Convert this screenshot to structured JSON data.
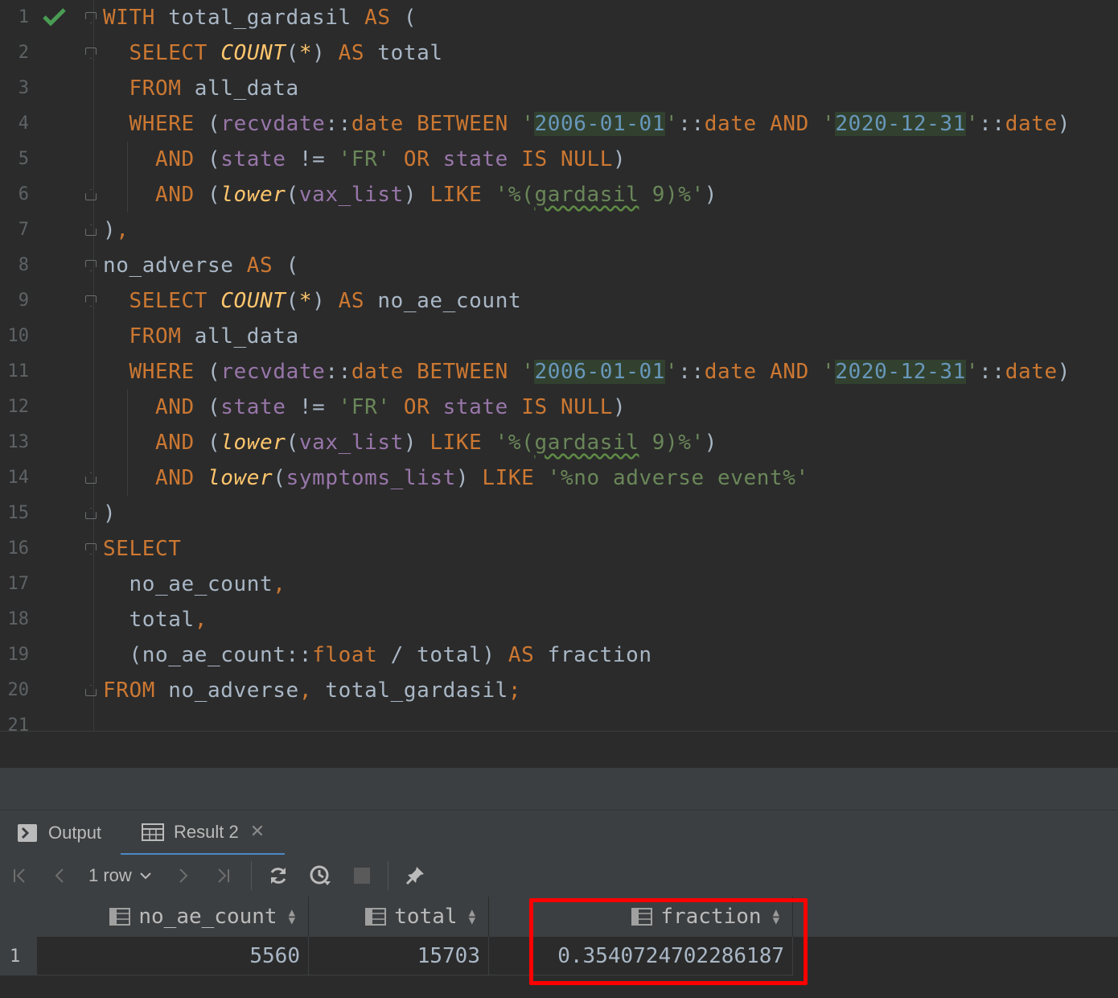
{
  "editor": {
    "status_icon": "check-icon",
    "lines": [
      {
        "n": "1"
      },
      {
        "n": "2"
      },
      {
        "n": "3"
      },
      {
        "n": "4"
      },
      {
        "n": "5"
      },
      {
        "n": "6"
      },
      {
        "n": "7"
      },
      {
        "n": "8"
      },
      {
        "n": "9"
      },
      {
        "n": "10"
      },
      {
        "n": "11"
      },
      {
        "n": "12"
      },
      {
        "n": "13"
      },
      {
        "n": "14"
      },
      {
        "n": "15"
      },
      {
        "n": "16"
      },
      {
        "n": "17"
      },
      {
        "n": "18"
      },
      {
        "n": "19"
      },
      {
        "n": "20"
      },
      {
        "n": "21"
      }
    ],
    "code": [
      [
        [
          "kw",
          "WITH"
        ],
        [
          "op",
          " total_gardasil "
        ],
        [
          "kw",
          "AS"
        ],
        [
          "op",
          " ("
        ]
      ],
      [
        [
          "op",
          "  "
        ],
        [
          "kw",
          "SELECT"
        ],
        [
          "op",
          " "
        ],
        [
          "fn",
          "COUNT"
        ],
        [
          "op",
          "("
        ],
        [
          "fn",
          "*"
        ],
        [
          "op",
          ") "
        ],
        [
          "kw",
          "AS"
        ],
        [
          "op",
          " total"
        ]
      ],
      [
        [
          "op",
          "  "
        ],
        [
          "kw",
          "FROM"
        ],
        [
          "op",
          " all_data"
        ]
      ],
      [
        [
          "op",
          "  "
        ],
        [
          "kw",
          "WHERE"
        ],
        [
          "op",
          " ("
        ],
        [
          "col",
          "recvdate"
        ],
        [
          "op",
          "::"
        ],
        [
          "kw",
          "date"
        ],
        [
          "op",
          " "
        ],
        [
          "kw",
          "BETWEEN"
        ],
        [
          "op",
          " "
        ],
        [
          "str",
          "'"
        ],
        [
          "dt",
          "2006-01-01"
        ],
        [
          "str",
          "'"
        ],
        [
          "op",
          "::"
        ],
        [
          "kw",
          "date"
        ],
        [
          "op",
          " "
        ],
        [
          "kw",
          "AND"
        ],
        [
          "op",
          " "
        ],
        [
          "str",
          "'"
        ],
        [
          "dt",
          "2020-12-31"
        ],
        [
          "str",
          "'"
        ],
        [
          "op",
          "::"
        ],
        [
          "kw",
          "date"
        ],
        [
          "op",
          ")"
        ]
      ],
      [
        [
          "op",
          "    "
        ],
        [
          "kw",
          "AND"
        ],
        [
          "op",
          " ("
        ],
        [
          "col",
          "state"
        ],
        [
          "op",
          " != "
        ],
        [
          "str",
          "'FR'"
        ],
        [
          "op",
          " "
        ],
        [
          "kw",
          "OR"
        ],
        [
          "op",
          " "
        ],
        [
          "col",
          "state"
        ],
        [
          "op",
          " "
        ],
        [
          "kw",
          "IS NULL"
        ],
        [
          "op",
          ")"
        ]
      ],
      [
        [
          "op",
          "    "
        ],
        [
          "kw",
          "AND"
        ],
        [
          "op",
          " ("
        ],
        [
          "fn",
          "lower"
        ],
        [
          "op",
          "("
        ],
        [
          "col",
          "vax_list"
        ],
        [
          "op",
          ") "
        ],
        [
          "kw",
          "LIKE"
        ],
        [
          "op",
          " "
        ],
        [
          "str",
          "'%("
        ],
        [
          "strtypo",
          "gardasil"
        ],
        [
          "str",
          " 9)%'"
        ],
        [
          "op",
          ")"
        ]
      ],
      [
        [
          "op",
          ")"
        ],
        [
          "kw",
          ","
        ]
      ],
      [
        [
          "op",
          "no_adverse "
        ],
        [
          "kw",
          "AS"
        ],
        [
          "op",
          " ("
        ]
      ],
      [
        [
          "op",
          "  "
        ],
        [
          "kw",
          "SELECT"
        ],
        [
          "op",
          " "
        ],
        [
          "fn",
          "COUNT"
        ],
        [
          "op",
          "("
        ],
        [
          "fn",
          "*"
        ],
        [
          "op",
          ") "
        ],
        [
          "kw",
          "AS"
        ],
        [
          "op",
          " no_ae_count"
        ]
      ],
      [
        [
          "op",
          "  "
        ],
        [
          "kw",
          "FROM"
        ],
        [
          "op",
          " all_data"
        ]
      ],
      [
        [
          "op",
          "  "
        ],
        [
          "kw",
          "WHERE"
        ],
        [
          "op",
          " ("
        ],
        [
          "col",
          "recvdate"
        ],
        [
          "op",
          "::"
        ],
        [
          "kw",
          "date"
        ],
        [
          "op",
          " "
        ],
        [
          "kw",
          "BETWEEN"
        ],
        [
          "op",
          " "
        ],
        [
          "str",
          "'"
        ],
        [
          "dt",
          "2006-01-01"
        ],
        [
          "str",
          "'"
        ],
        [
          "op",
          "::"
        ],
        [
          "kw",
          "date"
        ],
        [
          "op",
          " "
        ],
        [
          "kw",
          "AND"
        ],
        [
          "op",
          " "
        ],
        [
          "str",
          "'"
        ],
        [
          "dt",
          "2020-12-31"
        ],
        [
          "str",
          "'"
        ],
        [
          "op",
          "::"
        ],
        [
          "kw",
          "date"
        ],
        [
          "op",
          ")"
        ]
      ],
      [
        [
          "op",
          "    "
        ],
        [
          "kw",
          "AND"
        ],
        [
          "op",
          " ("
        ],
        [
          "col",
          "state"
        ],
        [
          "op",
          " != "
        ],
        [
          "str",
          "'FR'"
        ],
        [
          "op",
          " "
        ],
        [
          "kw",
          "OR"
        ],
        [
          "op",
          " "
        ],
        [
          "col",
          "state"
        ],
        [
          "op",
          " "
        ],
        [
          "kw",
          "IS NULL"
        ],
        [
          "op",
          ")"
        ]
      ],
      [
        [
          "op",
          "    "
        ],
        [
          "kw",
          "AND"
        ],
        [
          "op",
          " ("
        ],
        [
          "fn",
          "lower"
        ],
        [
          "op",
          "("
        ],
        [
          "col",
          "vax_list"
        ],
        [
          "op",
          ") "
        ],
        [
          "kw",
          "LIKE"
        ],
        [
          "op",
          " "
        ],
        [
          "str",
          "'%("
        ],
        [
          "strtypo",
          "gardasil"
        ],
        [
          "str",
          " 9)%'"
        ],
        [
          "op",
          ")"
        ]
      ],
      [
        [
          "op",
          "    "
        ],
        [
          "kw",
          "AND"
        ],
        [
          "op",
          " "
        ],
        [
          "fn",
          "lower"
        ],
        [
          "op",
          "("
        ],
        [
          "col",
          "symptoms_list"
        ],
        [
          "op",
          ") "
        ],
        [
          "kw",
          "LIKE"
        ],
        [
          "op",
          " "
        ],
        [
          "str",
          "'%no adverse event%'"
        ]
      ],
      [
        [
          "op",
          ")"
        ]
      ],
      [
        [
          "kw",
          "SELECT"
        ]
      ],
      [
        [
          "op",
          "  no_ae_count"
        ],
        [
          "kw",
          ","
        ]
      ],
      [
        [
          "op",
          "  total"
        ],
        [
          "kw",
          ","
        ]
      ],
      [
        [
          "op",
          "  (no_ae_count::"
        ],
        [
          "kw",
          "float"
        ],
        [
          "op",
          " / total) "
        ],
        [
          "kw",
          "AS"
        ],
        [
          "op",
          " fraction"
        ]
      ],
      [
        [
          "kw",
          "FROM"
        ],
        [
          "op",
          " no_adverse"
        ],
        [
          "kw",
          ","
        ],
        [
          "op",
          " total_gardasil"
        ],
        [
          "kw",
          ";"
        ]
      ],
      []
    ]
  },
  "results": {
    "tabs": {
      "output_label": "Output",
      "result_label": "Result 2",
      "output_icon": "console-icon",
      "result_icon": "table-icon",
      "close_icon": "close-icon"
    },
    "toolbar": {
      "row_count": "1 row",
      "icons": [
        "first-page-icon",
        "prev-page-icon",
        "next-page-icon",
        "last-page-icon",
        "refresh-icon",
        "history-icon",
        "stop-icon",
        "pin-icon"
      ]
    },
    "columns": [
      "no_ae_count",
      "total",
      "fraction"
    ],
    "rows": [
      {
        "num": "1",
        "values": [
          "5560",
          "15703",
          "0.3540724702286187"
        ]
      }
    ],
    "highlight_color": "#ff0000"
  }
}
